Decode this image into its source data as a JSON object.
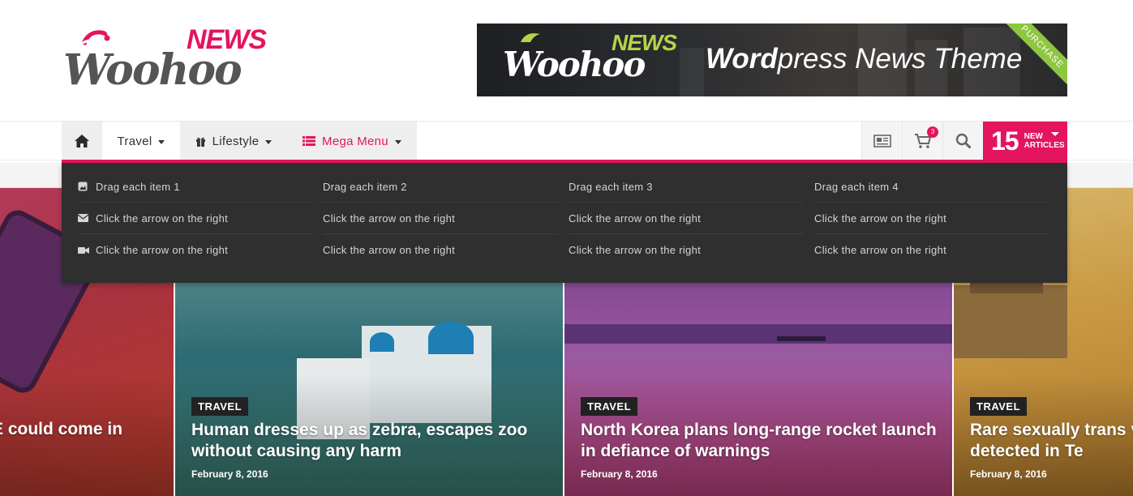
{
  "brand": {
    "news": "NEWS",
    "name": "Woohoo"
  },
  "banner": {
    "news": "NEWS",
    "name": "Woohoo",
    "tagline_bold": "Word",
    "tagline_rest": "press News Theme",
    "ribbon": "PURCHASE"
  },
  "nav": {
    "items": [
      {
        "label": "Travel"
      },
      {
        "label": "Lifestyle"
      },
      {
        "label": "Mega Menu"
      }
    ],
    "cart_count": "3",
    "new_count": "15",
    "new_label_1": "NEW",
    "new_label_2": "ARTICLES"
  },
  "mega_menu": {
    "columns": [
      {
        "items": [
          "Drag each item 1",
          "Click the arrow on the right",
          "Click the arrow on the right"
        ]
      },
      {
        "items": [
          "Drag each item 2",
          "Click the arrow on the right",
          "Click the arrow on the right"
        ]
      },
      {
        "items": [
          "Drag each item 3",
          "Click the arrow on the right",
          "Click the arrow on the right"
        ]
      },
      {
        "items": [
          "Drag each item 4",
          "Click the arrow on the right",
          "Click the arrow on the right"
        ]
      }
    ]
  },
  "posts": [
    {
      "title": "E could come in"
    },
    {
      "category": "TRAVEL",
      "title": "Human dresses up as zebra, escapes zoo without causing any harm",
      "date": "February 8, 2016"
    },
    {
      "category": "TRAVEL",
      "title": "North Korea plans long-range rocket launch in defiance of warnings",
      "date": "February 8, 2016"
    },
    {
      "category": "TRAVEL",
      "title": "Rare sexually trans virus detected in Te",
      "date": "February 8, 2016"
    }
  ],
  "colors": {
    "accent": "#e5145e",
    "menu_bg": "#2f2f2f",
    "ribbon": "#8dc63f"
  }
}
